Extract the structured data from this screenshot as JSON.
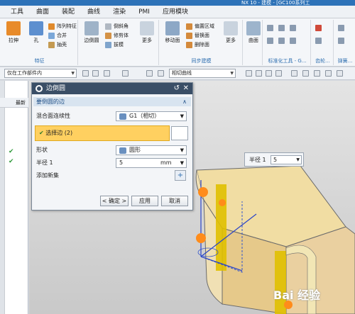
{
  "title": {
    "text": "NX 10 - 建模 - [GC100系列工"
  },
  "menu": [
    "工具",
    "曲面",
    "装配",
    "曲线",
    "渲染",
    "PMI",
    "应用模块"
  ],
  "ribbon": {
    "groups": [
      {
        "label": "特征",
        "big": [
          "拉伸",
          "孔"
        ],
        "small": [
          "阵列特征",
          "合并",
          "抽壳"
        ]
      },
      {
        "label": "",
        "big": [
          "边倒圆"
        ],
        "small": [
          "倒斜角",
          "修剪体",
          "拔模"
        ],
        "more": "更多"
      },
      {
        "label": "同步建模",
        "big": [
          "移动面"
        ],
        "small": [
          "偏置区域",
          "替换面",
          "删除面"
        ],
        "more": "更多"
      },
      {
        "label": "",
        "big": [
          "曲面"
        ]
      },
      {
        "label": "标准化工具 - G...",
        "big": []
      },
      {
        "label": "齿轮...",
        "big": []
      },
      {
        "label": "弹簧...",
        "big": []
      }
    ]
  },
  "filterbar": {
    "scope": "仅在工作部件内",
    "curve_rule": "相切曲线"
  },
  "navigator": {
    "header": "最新"
  },
  "dialog": {
    "title": "边倒圆",
    "section": "要倒圆的边",
    "continuity_label": "混合面连续性",
    "continuity_value": "G1（相切）",
    "select_edge": "选择边 (2)",
    "shape_label": "形状",
    "shape_value": "圆形",
    "radius_label": "半径 1",
    "radius_value": "5",
    "radius_unit": "mm",
    "add_set": "添加新集",
    "ok": "< 确定 >",
    "apply": "应用",
    "cancel": "取消"
  },
  "radius_popup": {
    "label": "半径 1",
    "value": "5"
  },
  "watermark": "Bai 经验",
  "colors": {
    "dialog_title": "#3a4e66",
    "selection": "#ffd060",
    "body": "#f0d99a",
    "edge": "#e0c000",
    "sphere": "#ff8c1a"
  }
}
